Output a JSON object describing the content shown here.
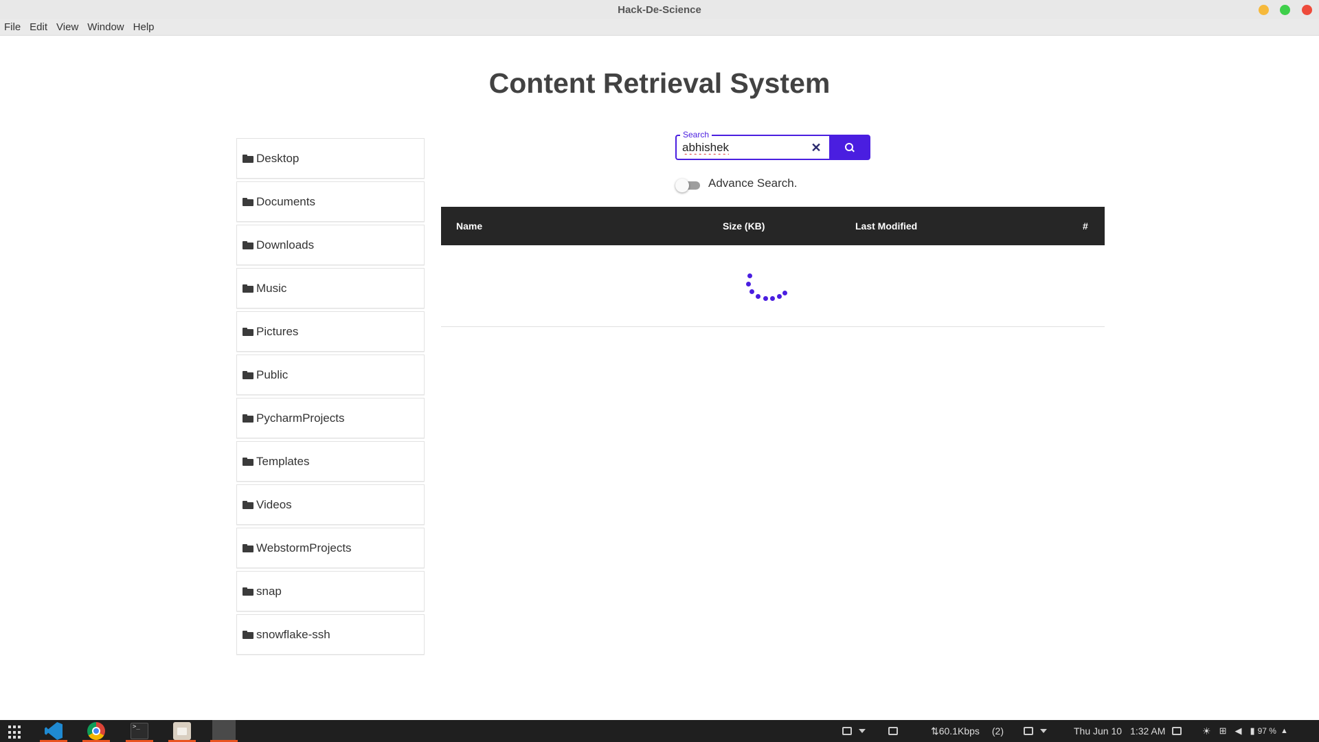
{
  "window": {
    "title": "Hack-De-Science"
  },
  "menu": [
    "File",
    "Edit",
    "View",
    "Window",
    "Help"
  ],
  "app": {
    "title": "Content Retrieval System"
  },
  "folders": [
    "Desktop",
    "Documents",
    "Downloads",
    "Music",
    "Pictures",
    "Public",
    "PycharmProjects",
    "Templates",
    "Videos",
    "WebstormProjects",
    "snap",
    "snowflake-ssh"
  ],
  "search": {
    "legend": "Search",
    "value": "abhishek",
    "clear_symbol": "✕"
  },
  "advance_search": {
    "label": "Advance Search.",
    "enabled": false
  },
  "table": {
    "columns": [
      "Name",
      "Size (KB)",
      "Last Modified",
      "#"
    ],
    "loading": true
  },
  "taskbar": {
    "network_speed": "⇅60.1Kbps",
    "notification_count": "(2)",
    "date": "Thu Jun 10",
    "time": "1:32 AM",
    "battery": "97 %",
    "terminal_glyph": ">_"
  },
  "colors": {
    "accent": "#4a1ee0",
    "table_header": "#262626"
  }
}
